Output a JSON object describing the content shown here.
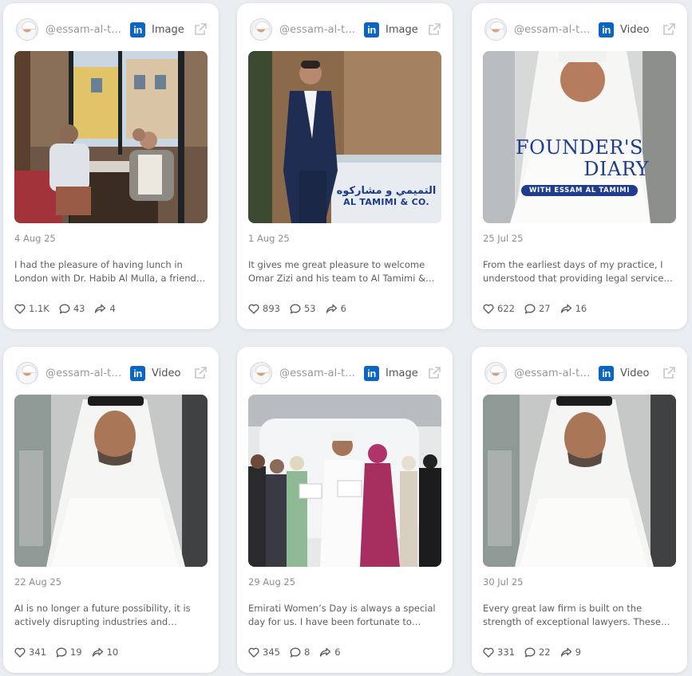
{
  "colors": {
    "page_bg": "#eaedf1",
    "card_bg": "#ffffff",
    "linkedin_blue": "#0a66c2",
    "muted_text": "#8b8f96"
  },
  "icons": {
    "platform": "linkedin-icon",
    "open": "external-link-icon",
    "likes": "heart-icon",
    "comments": "comment-icon",
    "shares": "share-icon"
  },
  "posts": [
    {
      "handle": "@essam-al-t...",
      "platform": "in",
      "media_type": "Image",
      "date": "4 Aug 25",
      "text": "I had the pleasure of having lunch in London with Dr. Habib Al Mulla, a friend…",
      "likes": "1.1K",
      "comments": "43",
      "shares": "4"
    },
    {
      "handle": "@essam-al-t...",
      "platform": "in",
      "media_type": "Image",
      "date": "1 Aug 25",
      "text": "It gives me great pleasure to welcome Omar Zizi and his team to Al Tamimi &…",
      "likes": "893",
      "comments": "53",
      "shares": "6",
      "media_sign_arabic": "التميمي و مشاركوه",
      "media_sign_latin": "AL TAMIMI & CO."
    },
    {
      "handle": "@essam-al-ta...",
      "platform": "in",
      "media_type": "Video",
      "date": "25 Jul 25",
      "text": "From the earliest days of my practice, I understood that providing legal service…",
      "likes": "622",
      "comments": "27",
      "shares": "16",
      "media_title_1": "FOUNDER'S",
      "media_title_2": "DIARY",
      "media_subtitle": "WITH ESSAM AL TAMIMI"
    },
    {
      "handle": "@essam-al-ta...",
      "platform": "in",
      "media_type": "Video",
      "date": "22 Aug 25",
      "text": "AI is no longer a future possibility, it is actively disrupting industries and…",
      "likes": "341",
      "comments": "19",
      "shares": "10"
    },
    {
      "handle": "@essam-al-t...",
      "platform": "in",
      "media_type": "Image",
      "date": "29 Aug 25",
      "text": "Emirati Women’s Day is always a special day for us. I have been fortunate to…",
      "likes": "345",
      "comments": "8",
      "shares": "6"
    },
    {
      "handle": "@essam-al-ta...",
      "platform": "in",
      "media_type": "Video",
      "date": "30 Jul 25",
      "text": "Every great law firm is built on the strength of exceptional lawyers. These…",
      "likes": "331",
      "comments": "22",
      "shares": "9"
    }
  ]
}
